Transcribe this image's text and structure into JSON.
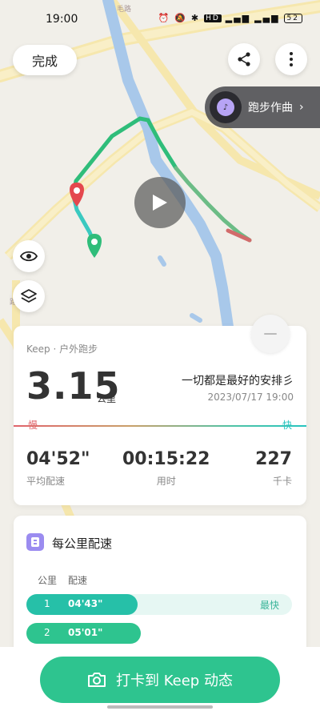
{
  "status_bar": {
    "time": "19:00",
    "battery": "52",
    "network_badge": "HD"
  },
  "map": {
    "road_labels": [
      "毛路",
      "路"
    ],
    "done_label": "完成",
    "music_label": "跑步作曲",
    "icons": [
      "share-icon",
      "more-icon",
      "play-icon",
      "eye-icon",
      "layers-icon"
    ]
  },
  "summary": {
    "source": "Keep · 户外跑步",
    "distance": "3.15",
    "distance_unit": "公里",
    "route_title": "一切都是最好的安排彡",
    "date": "2023/07/17 19:00",
    "slow_label": "慢",
    "fast_label": "快",
    "stats": [
      {
        "value": "04'52\"",
        "label": "平均配速"
      },
      {
        "value": "00:15:22",
        "label": "用时"
      },
      {
        "value": "227",
        "label": "千卡"
      }
    ]
  },
  "km_pace": {
    "title": "每公里配速",
    "col_km": "公里",
    "col_pace": "配速",
    "rows": [
      {
        "km": "1",
        "pace": "04'43\"",
        "tag": "最快",
        "fraction": 0.42,
        "color": "#26c0a8"
      },
      {
        "km": "2",
        "pace": "05'01\"",
        "tag": "",
        "fraction": 0.43,
        "color": "#2ec48f"
      }
    ]
  },
  "cta": {
    "label": "打卡到 Keep 动态"
  },
  "colors": {
    "accent": "#2ec48f",
    "slow": "#e0646b",
    "fast": "#27c4c0"
  }
}
